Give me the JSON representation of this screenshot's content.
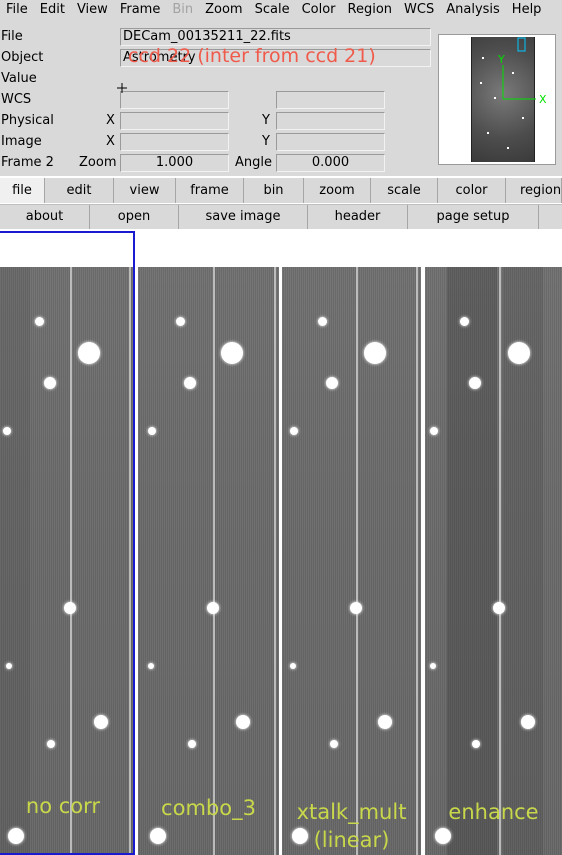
{
  "menubar": {
    "items": [
      "File",
      "Edit",
      "View",
      "Frame",
      "Bin",
      "Zoom",
      "Scale",
      "Color",
      "Region",
      "WCS",
      "Analysis",
      "Help"
    ],
    "disabled": [
      "Bin"
    ]
  },
  "info": {
    "file_label": "File",
    "file_value": "DECam_00135211_22.fits",
    "object_label": "Object",
    "object_value": "Astrometry",
    "value_label": "Value",
    "wcs_label": "WCS",
    "physical_label": "Physical",
    "image_label": "Image",
    "frame_label": "Frame 2",
    "x_label": "X",
    "y_label": "Y",
    "zoom_label": "Zoom",
    "zoom_value": "1.000",
    "angle_label": "Angle",
    "angle_value": "0.000"
  },
  "overlay_text": "ccd 22 (inter from ccd 21)",
  "panner": {
    "axis_x": "X",
    "axis_y": "Y",
    "compass_color": "#00e000",
    "box_color": "#00c8ff"
  },
  "buttonbar": {
    "items": [
      "file",
      "edit",
      "view",
      "frame",
      "bin",
      "zoom",
      "scale",
      "color",
      "region"
    ],
    "active": "file"
  },
  "subbar": {
    "items": [
      "about",
      "open",
      "save image",
      "header",
      "page setup"
    ]
  },
  "frames": [
    {
      "label_line1": "no corr",
      "label_line2": ""
    },
    {
      "label_line1": "combo_3",
      "label_line2": ""
    },
    {
      "label_line1": "xtalk_mult",
      "label_line2": "(linear)"
    },
    {
      "label_line1": "enhance",
      "label_line2": ""
    }
  ],
  "colors": {
    "overlay_text": "#f05a4a",
    "frame_label": "#c8d84a",
    "current_frame_border": "#1a1ad0",
    "ui_background": "#d9d9d9"
  }
}
